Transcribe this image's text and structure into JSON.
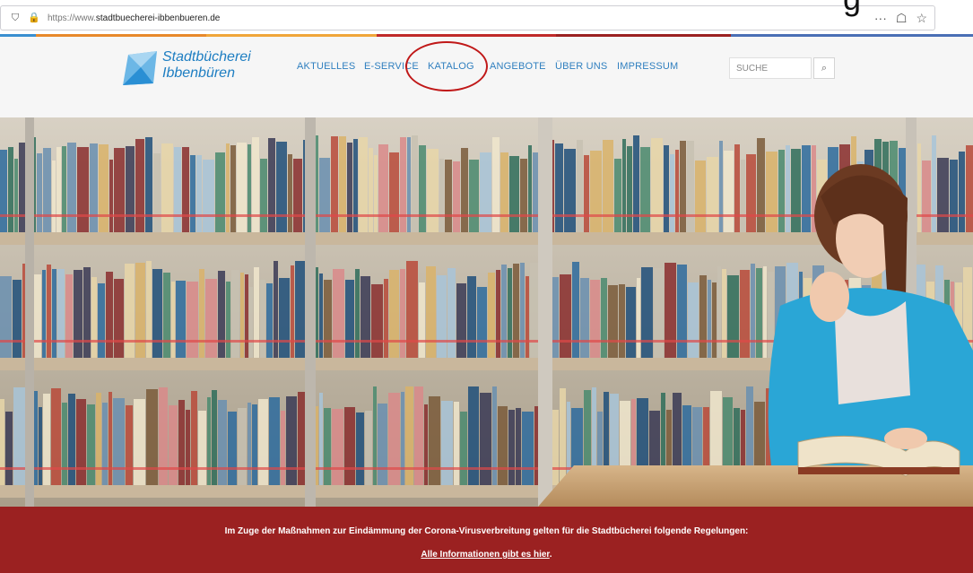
{
  "browser": {
    "url_prefix": "https://www.",
    "url_host": "stadtbuecherei-ibbenbueren.de",
    "icons": [
      "shield-icon",
      "lock-icon",
      "more-icon",
      "pocket-icon",
      "star-icon"
    ]
  },
  "stripe_colors": [
    "#3a8fd0",
    "#e8892b",
    "#f0a63a",
    "#c02a2a",
    "#9b2121",
    "#4a6fb5"
  ],
  "logo": {
    "line1": "Stadtbücherei",
    "line2": "Ibbenbüren",
    "color": "#1e7ec2"
  },
  "nav": [
    {
      "label": "AKTUELLES"
    },
    {
      "label": "E-SERVICE"
    },
    {
      "label": "KATALOG"
    },
    {
      "label": "ANGEBOTE"
    },
    {
      "label": "ÜBER UNS"
    },
    {
      "label": "IMPRESSUM"
    }
  ],
  "search": {
    "placeholder": "SUCHE"
  },
  "banner": {
    "line1": "Im Zuge der Maßnahmen zur Eindämmung der Corona-Virusverbreitung gelten für die Stadtbücherei folgende Regelungen:",
    "link": "Alle Informationen gibt es hier",
    "link_suffix": ".",
    "color": "#9b2121"
  },
  "cropped_heading_glyph": "g"
}
